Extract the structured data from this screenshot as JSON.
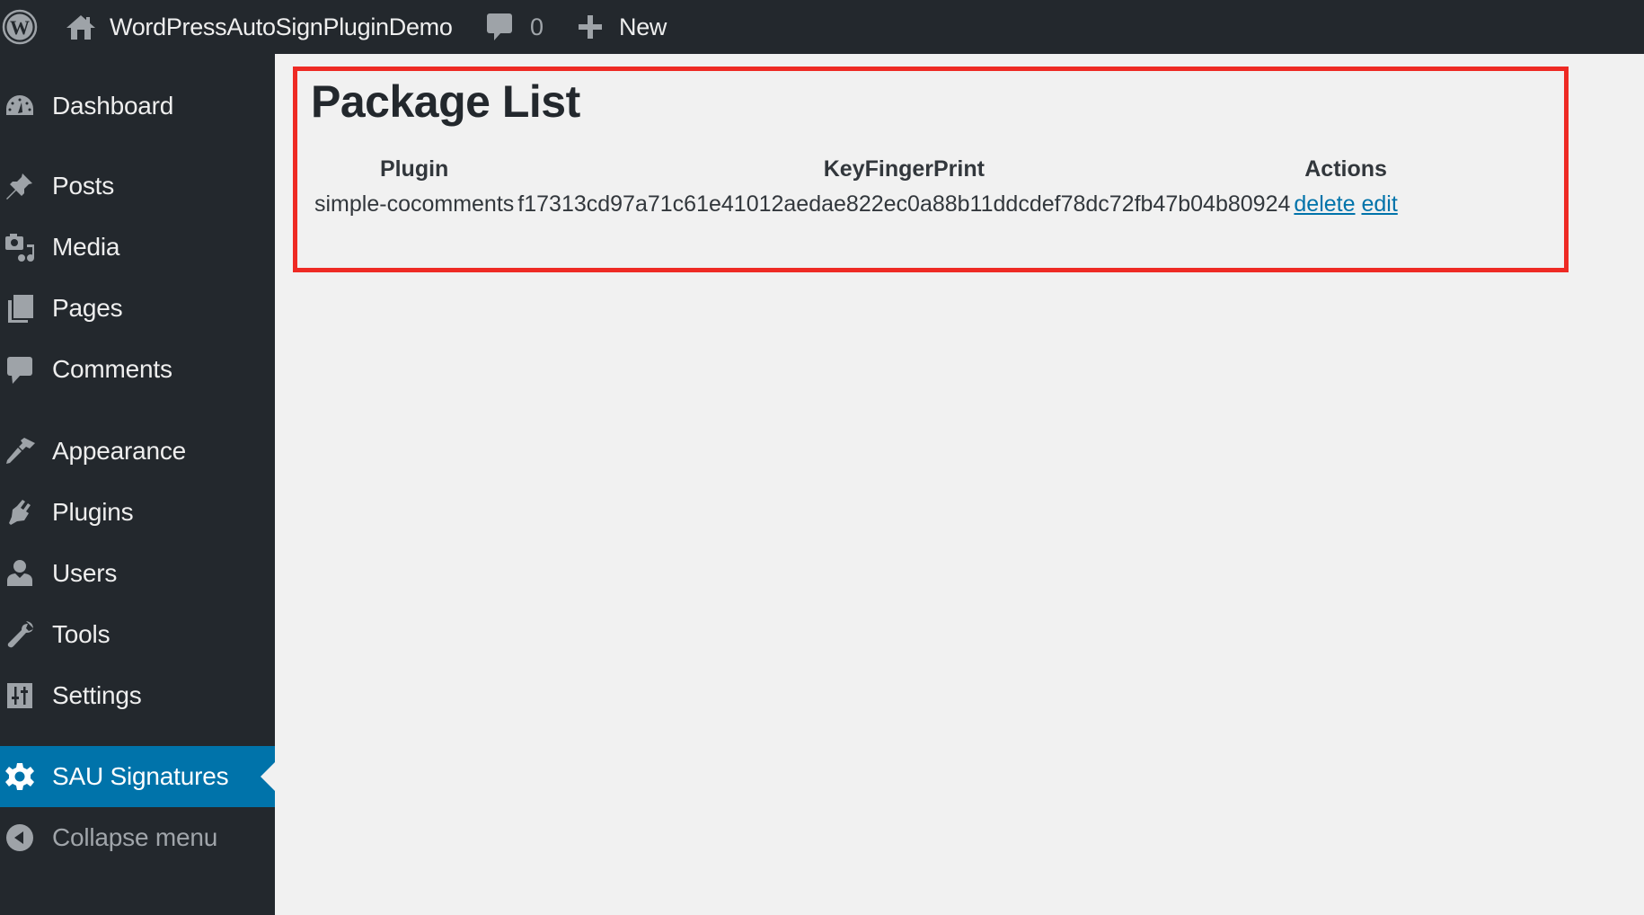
{
  "adminbar": {
    "site_title": "WordPressAutoSignPluginDemo",
    "comments_count": "0",
    "new_label": "New"
  },
  "sidebar": {
    "items": [
      {
        "label": "Dashboard",
        "icon": "dashboard-icon"
      },
      {
        "label": "Posts",
        "icon": "pin-icon"
      },
      {
        "label": "Media",
        "icon": "media-icon"
      },
      {
        "label": "Pages",
        "icon": "pages-icon"
      },
      {
        "label": "Comments",
        "icon": "comment-icon"
      },
      {
        "label": "Appearance",
        "icon": "paintbrush-icon"
      },
      {
        "label": "Plugins",
        "icon": "plugin-icon"
      },
      {
        "label": "Users",
        "icon": "user-icon"
      },
      {
        "label": "Tools",
        "icon": "wrench-icon"
      },
      {
        "label": "Settings",
        "icon": "settings-icon"
      },
      {
        "label": "SAU Signatures",
        "icon": "gear-icon",
        "active": true
      },
      {
        "label": "Collapse menu",
        "icon": "collapse-icon"
      }
    ]
  },
  "main": {
    "title": "Package List",
    "table": {
      "headers": [
        "Plugin",
        "KeyFingerPrint",
        "Actions"
      ],
      "rows": [
        {
          "plugin": "simple-cocomments",
          "fingerprint": "f17313cd97a71c61e41012aedae822ec0a88b11ddcdef78dc72fb47b04b80924",
          "actions": [
            "delete",
            "edit"
          ]
        }
      ]
    }
  },
  "colors": {
    "adminbar_bg": "#23282d",
    "active_menu": "#0073aa",
    "link": "#0073aa",
    "highlight_box": "#ee2a24",
    "content_bg": "#f1f1f1"
  }
}
